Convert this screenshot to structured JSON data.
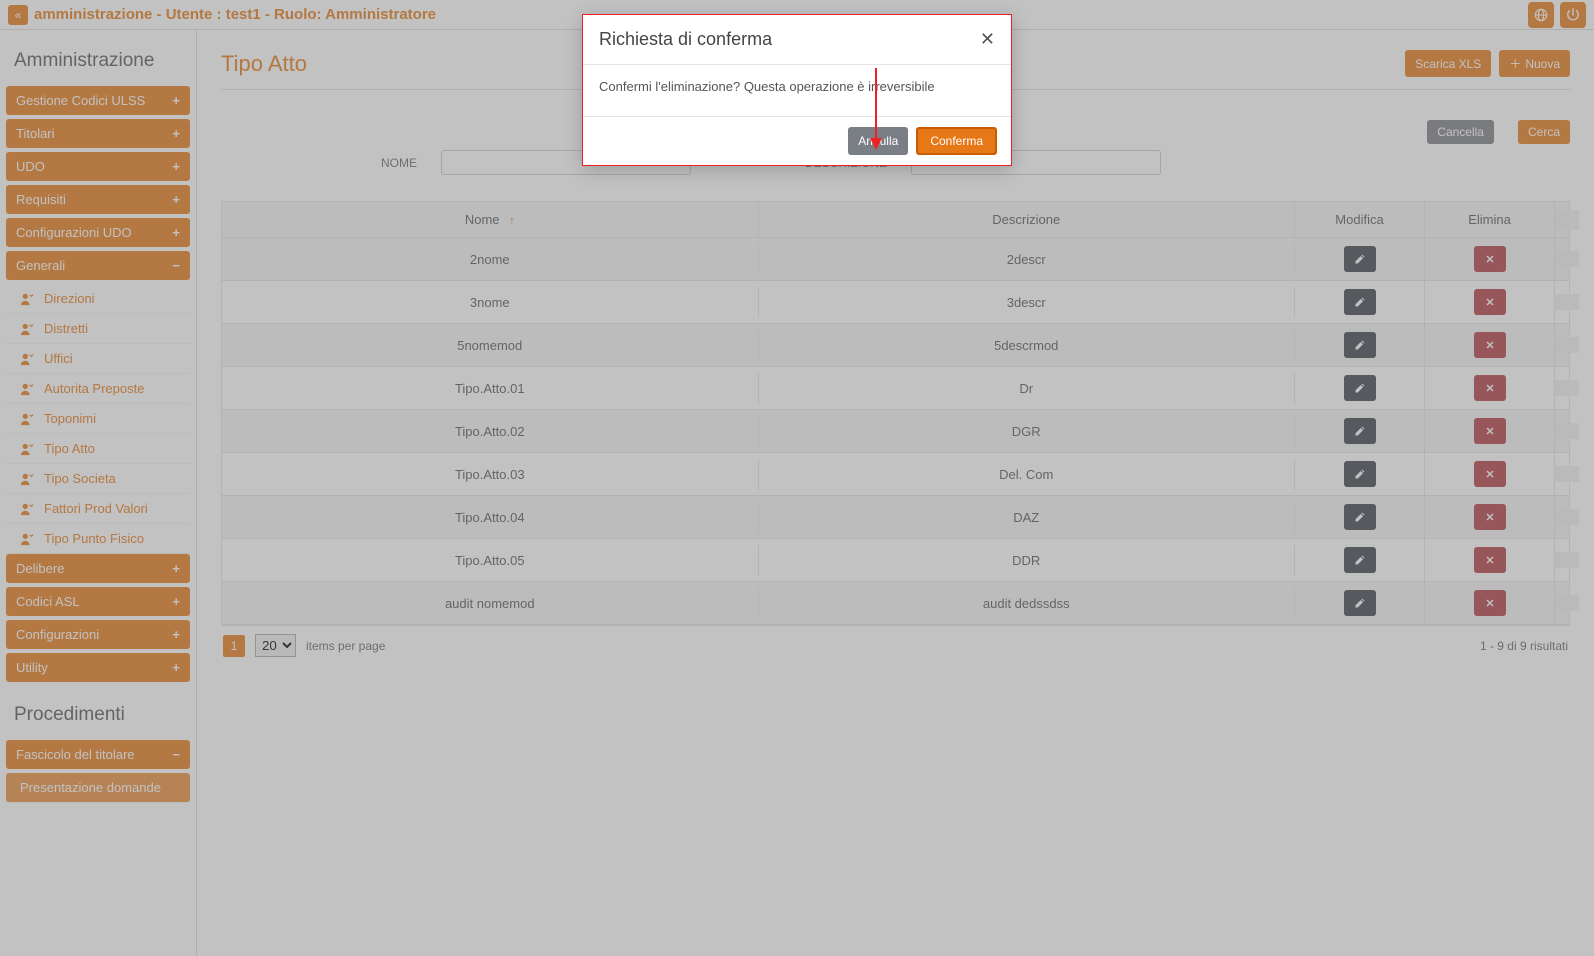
{
  "topbar": {
    "title": "amministrazione - Utente : test1 - Ruolo: Amministratore"
  },
  "sidebar": {
    "section1_title": "Amministrazione",
    "groups1": [
      {
        "label": "Gestione Codici ULSS",
        "icon": "+"
      },
      {
        "label": "Titolari",
        "icon": "+"
      },
      {
        "label": "UDO",
        "icon": "+"
      },
      {
        "label": "Requisiti",
        "icon": "+"
      },
      {
        "label": "Configurazioni UDO",
        "icon": "+"
      }
    ],
    "group_generali": {
      "label": "Generali",
      "icon": "−"
    },
    "generali_items": [
      "Direzioni",
      "Distretti",
      "Uffici",
      "Autorita Preposte",
      "Toponimi",
      "Tipo Atto",
      "Tipo Societa",
      "Fattori Prod Valori",
      "Tipo Punto Fisico"
    ],
    "groups2": [
      {
        "label": "Delibere",
        "icon": "+"
      },
      {
        "label": "Codici ASL",
        "icon": "+"
      },
      {
        "label": "Configurazioni",
        "icon": "+"
      },
      {
        "label": "Utility",
        "icon": "+"
      }
    ],
    "section2_title": "Procedimenti",
    "group_fascicolo": {
      "label": "Fascicolo del titolare",
      "icon": "−"
    },
    "fascicolo_item": "Presentazione domande"
  },
  "page": {
    "title": "Tipo Atto",
    "btn_xls": "Scarica XLS",
    "btn_new": "Nuova",
    "btn_cancel": "Cancella",
    "btn_search": "Cerca",
    "filter_nome_label": "NOME",
    "filter_descr_label": "DESCRIZIONE"
  },
  "table": {
    "col_nome": "Nome",
    "col_descr": "Descrizione",
    "col_mod": "Modifica",
    "col_del": "Elimina",
    "rows": [
      {
        "nome": "2nome",
        "descr": "2descr"
      },
      {
        "nome": "3nome",
        "descr": "3descr"
      },
      {
        "nome": "5nomemod",
        "descr": "5descrmod"
      },
      {
        "nome": "Tipo.Atto.01",
        "descr": "Dr"
      },
      {
        "nome": "Tipo.Atto.02",
        "descr": "DGR"
      },
      {
        "nome": "Tipo.Atto.03",
        "descr": "Del. Com"
      },
      {
        "nome": "Tipo.Atto.04",
        "descr": "DAZ"
      },
      {
        "nome": "Tipo.Atto.05",
        "descr": "DDR"
      },
      {
        "nome": "audit nomemod",
        "descr": "audit dedssdss"
      }
    ]
  },
  "pager": {
    "page": "1",
    "size": "20",
    "per_page_label": "items per page",
    "results": "1 - 9 di 9 risultati"
  },
  "modal": {
    "title": "Richiesta di conferma",
    "body": "Confermi l'eliminazione? Questa operazione è irreversibile",
    "btn_cancel": "Annulla",
    "btn_confirm": "Conferma"
  }
}
